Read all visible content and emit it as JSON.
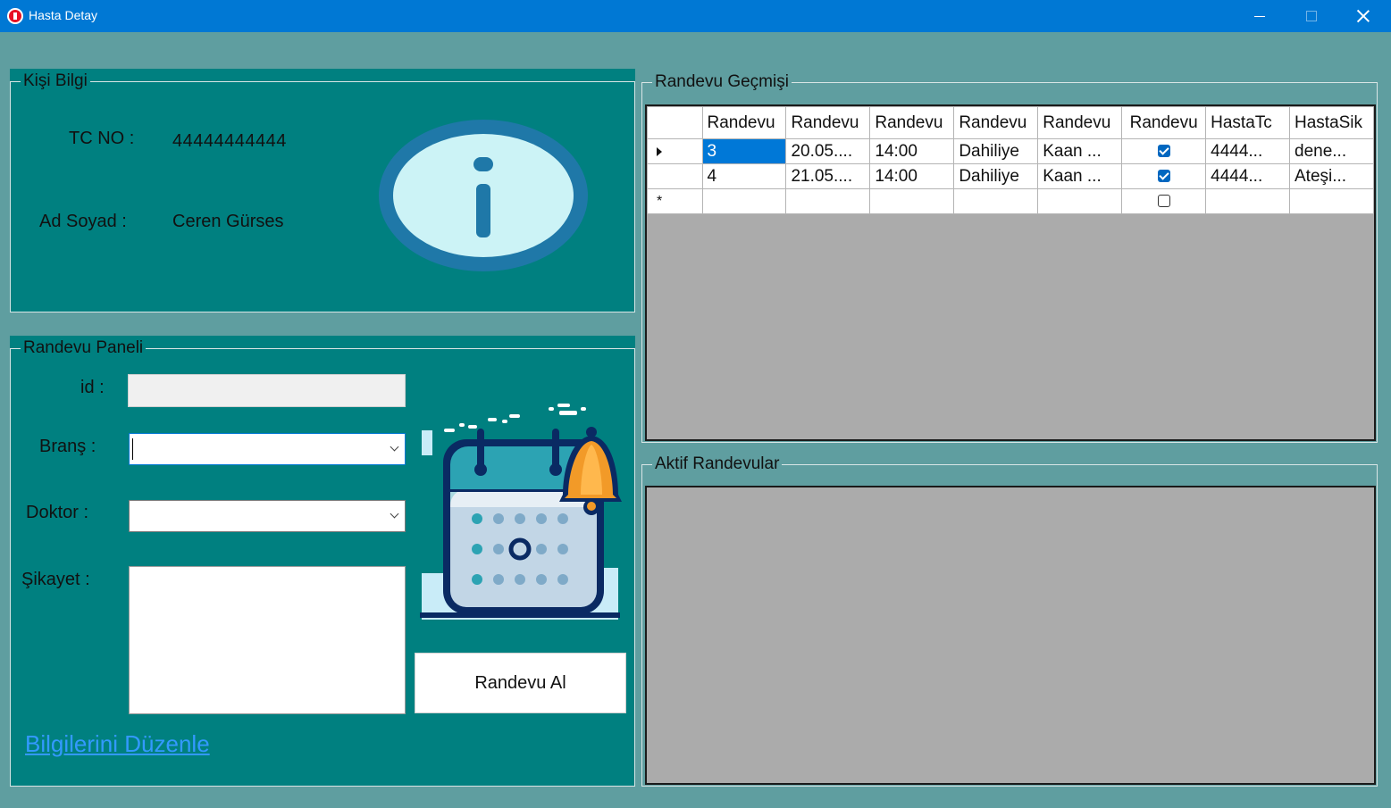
{
  "window": {
    "title": "Hasta Detay"
  },
  "kisi_bilgi": {
    "legend": "Kişi Bilgi",
    "tc_label": "TC NO :",
    "tc_value": "44444444444",
    "name_label": "Ad Soyad :",
    "name_value": "Ceren Gürses",
    "icon": "info-icon"
  },
  "randevu_paneli": {
    "legend": "Randevu Paneli",
    "id_label": "id :",
    "id_value": "",
    "brans_label": "Branş :",
    "brans_value": "",
    "doktor_label": "Doktor :",
    "doktor_value": "",
    "sikayet_label": "Şikayet :",
    "sikayet_value": "",
    "submit_label": "Randevu Al",
    "edit_link": "Bilgilerini Düzenle",
    "illustration": "calendar-bell-icon"
  },
  "randevu_gecmisi": {
    "legend": "Randevu Geçmişi",
    "columns": [
      "Randevu",
      "Randevu",
      "Randevu",
      "Randevu",
      "Randevu",
      "Randevu",
      "HastaTc",
      "HastaSik"
    ],
    "rows": [
      {
        "id": "3",
        "tarih": "20.05....",
        "saat": "14:00",
        "brans": "Dahiliye",
        "doktor": "Kaan ...",
        "durum": true,
        "tc": "4444...",
        "sikayet": "dene..."
      },
      {
        "id": "4",
        "tarih": "21.05....",
        "saat": "14:00",
        "brans": "Dahiliye",
        "doktor": "Kaan ...",
        "durum": true,
        "tc": "4444...",
        "sikayet": "Ateşi..."
      }
    ]
  },
  "aktif_randevular": {
    "legend": "Aktif Randevular"
  },
  "colors": {
    "form_background": "#5f9ea0",
    "panel_teal": "#008080",
    "titlebar": "#0078d4",
    "selection": "#0078d7",
    "link": "#3399ff",
    "grid_background": "#ababab"
  }
}
